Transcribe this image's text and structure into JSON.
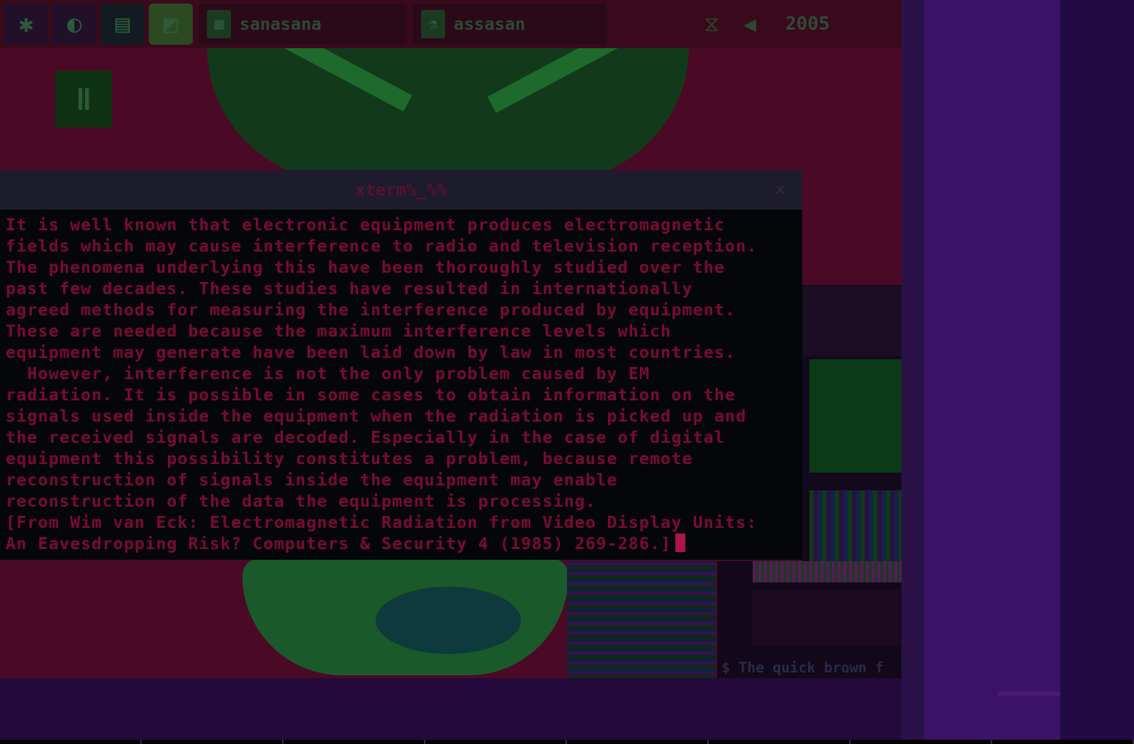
{
  "panel": {
    "launcher_icons": [
      "app-menu-icon",
      "browser-icon",
      "file-manager-icon",
      "image-viewer-icon"
    ],
    "tasks": [
      {
        "icon": "terminal-icon",
        "label": "sanasana"
      },
      {
        "icon": "window-icon",
        "label": "assasan"
      }
    ],
    "tray_icons": [
      "network-icon",
      "volume-icon"
    ],
    "clock": "2005"
  },
  "desktop_icon_glyph": "ǁ",
  "terminal": {
    "title": "xterm%_%%",
    "lines": [
      "It is well known that electronic equipment produces electromagnetic",
      "fields which may cause interference to radio and television reception.",
      "The phenomena underlying this have been thoroughly studied over the",
      "past few decades. These studies have resulted in internationally",
      "agreed methods for measuring the interference produced by equipment.",
      "These are needed because the maximum interference levels which",
      "equipment may generate have been laid down by law in most countries.",
      "  However, interference is not the only problem caused by EM",
      "radiation. It is possible in some cases to obtain information on the",
      "signals used inside the equipment when the radiation is picked up and",
      "the received signals are decoded. Especially in the case of digital",
      "equipment this possibility constitutes a problem, because remote",
      "reconstruction of signals inside the equipment may enable",
      "reconstruction of the data the equipment is processing.",
      "[From Wim van Eck: Electromagnetic Radiation from Video Display Units:",
      "An Eavesdropping Risk? Computers & Security 4 (1985) 269-286.]"
    ]
  },
  "small_window_text": "$ The quick brown f"
}
